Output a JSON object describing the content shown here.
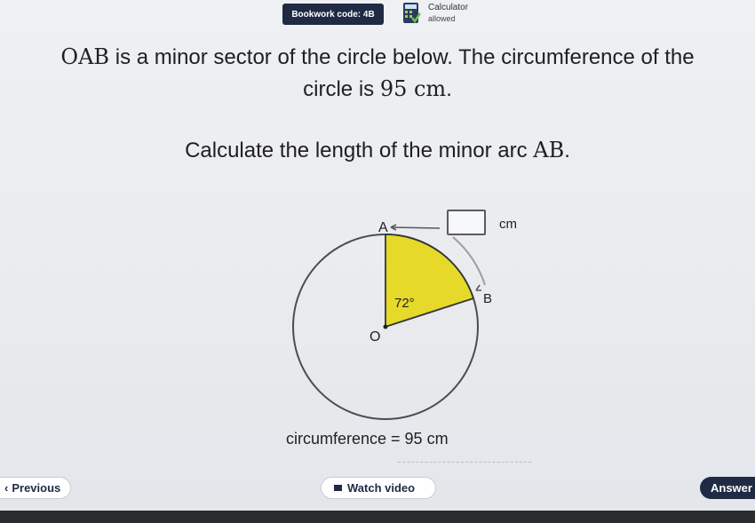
{
  "header": {
    "bookwork_code": "Bookwork code: 4B",
    "calculator_title": "Calculator",
    "calculator_status": "allowed"
  },
  "question": {
    "line1_prefix": "OAB",
    "line1_rest": " is a minor sector of the circle below. The circumference of the",
    "line2_prefix": "circle is ",
    "line2_value": "95 cm",
    "line2_suffix": ".",
    "line3_prefix": "Calculate the length of the minor arc ",
    "line3_value": "AB",
    "line3_suffix": "."
  },
  "diagram": {
    "label_a": "A",
    "label_b": "B",
    "label_o": "O",
    "angle": "72°",
    "sector_color": "#e6d92a",
    "answer_unit": "cm",
    "circumference_text": "circumference = 95 cm"
  },
  "buttons": {
    "previous": "Previous",
    "watch_video": "Watch video",
    "answer": "Answer"
  },
  "colors": {
    "navy": "#1f2a44"
  }
}
